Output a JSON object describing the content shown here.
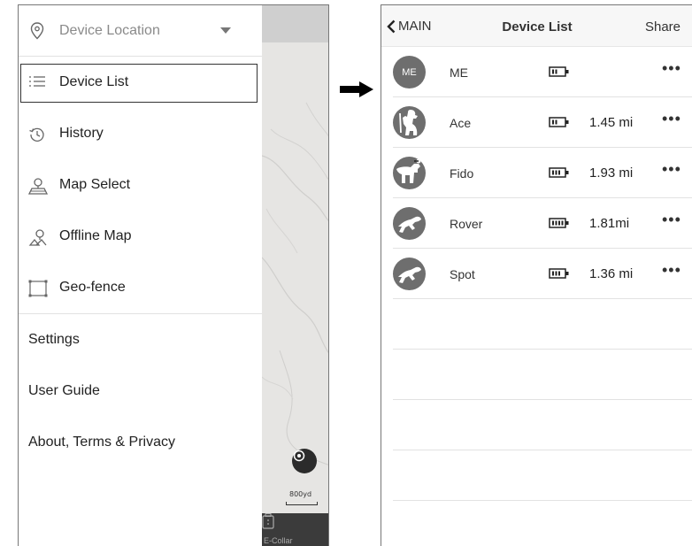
{
  "menu": {
    "location": {
      "label": "Device Location",
      "icon": "location-pin-icon"
    },
    "items": [
      {
        "label": "Device List",
        "icon": "list-icon",
        "selected": true
      },
      {
        "label": "History",
        "icon": "history-icon"
      },
      {
        "label": "Map Select",
        "icon": "map-pin-icon"
      },
      {
        "label": "Offline Map",
        "icon": "offline-map-icon"
      },
      {
        "label": "Geo-fence",
        "icon": "geofence-icon"
      }
    ],
    "links": [
      "Settings",
      "User Guide",
      "About, Terms & Privacy"
    ]
  },
  "map": {
    "scale_label": "800yd",
    "bottom_tab_label": "E-Collar"
  },
  "device_list": {
    "back_label": "MAIN",
    "title": "Device List",
    "share_label": "Share",
    "devices": [
      {
        "name": "ME",
        "avatar_text": "ME",
        "battery_bars": 2,
        "distance": "",
        "more": "•••"
      },
      {
        "name": "Ace",
        "avatar_icon": "dog-sitting-icon",
        "battery_bars": 2,
        "distance": "1.45 mi",
        "more": "•••"
      },
      {
        "name": "Fido",
        "avatar_icon": "dog-pointing-icon",
        "battery_bars": 3,
        "distance": "1.93 mi",
        "more": "•••"
      },
      {
        "name": "Rover",
        "avatar_icon": "dog-running-icon",
        "battery_bars": 4,
        "distance": "1.81mi",
        "more": "•••"
      },
      {
        "name": "Spot",
        "avatar_icon": "dog-running-icon",
        "battery_bars": 3,
        "distance": "1.36 mi",
        "more": "•••"
      }
    ]
  },
  "colors": {
    "avatar": "#6e6e6e",
    "map_background": "#e6e5e3",
    "selected_border": "#333333"
  }
}
